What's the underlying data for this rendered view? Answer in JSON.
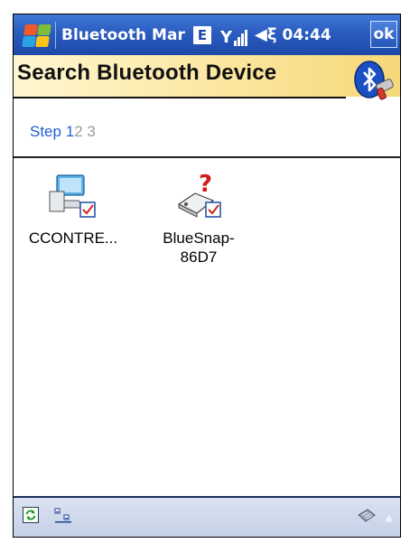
{
  "status_bar": {
    "app_title": "Bluetooth Mar",
    "network_badge": "E",
    "time": "04:44",
    "ok_label": "ok",
    "icons": [
      "windows-start-icon",
      "signal-icon",
      "speaker-icon"
    ]
  },
  "header": {
    "title": "Search Bluetooth Device",
    "logo_icon": "bluetooth-logo-icon"
  },
  "steps": {
    "prefix": "Step",
    "current": "1",
    "next1": "2",
    "next2": "3"
  },
  "devices": [
    {
      "name": "CCONTRE...",
      "icon": "computer-icon",
      "checked": true
    },
    {
      "name_line1": "BlueSnap-",
      "name_line2": "86D7",
      "icon": "unknown-device-icon",
      "checked": true
    }
  ],
  "bottom_bar": {
    "icons": [
      "refresh-icon",
      "view-mode-icon",
      "keyboard-icon",
      "keyboard-toggle-arrow-icon"
    ]
  },
  "colors": {
    "title_bar": "#2a5cc0",
    "banner": "#fbe59b",
    "step_active": "#1f5fd6",
    "step_inactive": "#9a9a9a"
  }
}
